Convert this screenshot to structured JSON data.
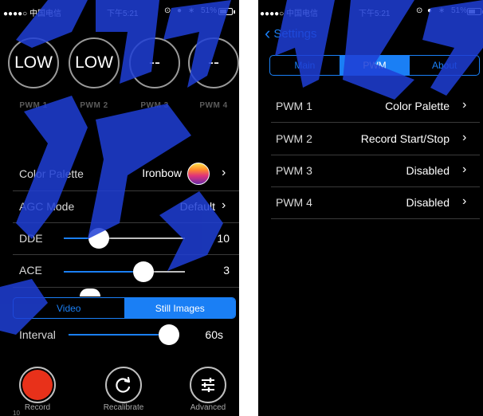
{
  "status": {
    "carrier": "●●●●○ 中国电信",
    "time": "下午5:21",
    "battery": "51%"
  },
  "main_screen": {
    "pwm_readouts": [
      {
        "value": "LOW",
        "label": "PWM 1"
      },
      {
        "value": "LOW",
        "label": "PWM 2"
      },
      {
        "value": "--",
        "label": "PWM 3"
      },
      {
        "value": "--",
        "label": "PWM 4"
      }
    ],
    "color_palette": {
      "label": "Color Palette",
      "value": "Ironbow"
    },
    "agc_mode": {
      "label": "AGC Mode",
      "value": "Default"
    },
    "dde": {
      "label": "DDE",
      "value": "10",
      "level": 0.29
    },
    "ace": {
      "label": "ACE",
      "value": "3",
      "level": 0.66
    },
    "mode_segment": {
      "options": [
        "Video",
        "Still Images"
      ],
      "selected": "Still Images"
    },
    "interval": {
      "label": "Interval",
      "value": "60s",
      "level": 1.0
    },
    "buttons": {
      "record": "Record",
      "recalibrate": "Recalibrate",
      "advanced": "Advanced"
    },
    "footer_number": "10"
  },
  "settings_screen": {
    "back_label": "Settings",
    "tabs": [
      "Main",
      "PWM",
      "About"
    ],
    "selected_tab": "PWM",
    "rows": [
      {
        "label": "PWM 1",
        "value": "Color Palette"
      },
      {
        "label": "PWM 2",
        "value": "Record Start/Stop"
      },
      {
        "label": "PWM 3",
        "value": "Disabled"
      },
      {
        "label": "PWM 4",
        "value": "Disabled"
      }
    ]
  },
  "colors": {
    "accent": "#1a7ff5",
    "record": "#e8311a"
  }
}
